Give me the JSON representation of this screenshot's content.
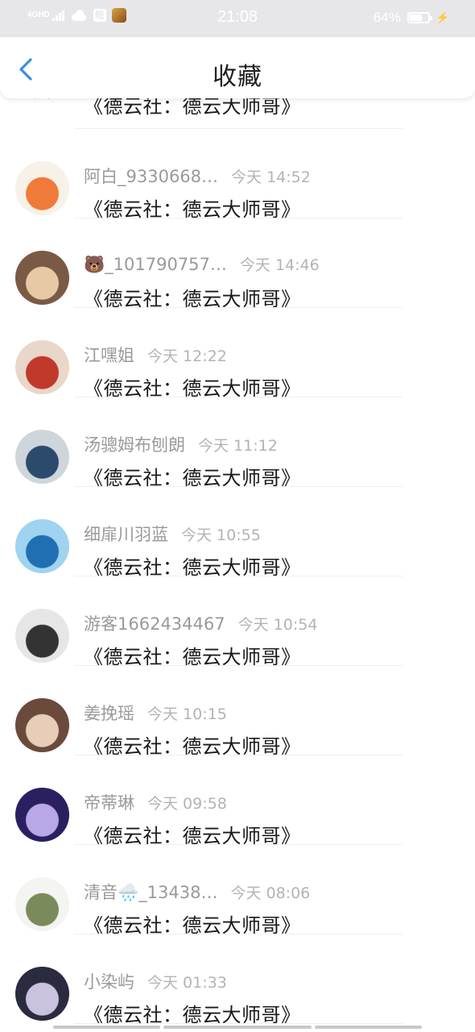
{
  "status_bar": {
    "network": "4GHD",
    "app_icon_1": "短",
    "time": "21:08",
    "battery_pct": "64%",
    "battery_level": 0.64,
    "icons": [
      "signal-icon",
      "cloud-icon",
      "app-icon",
      "game-icon",
      "battery-icon",
      "charging-icon"
    ]
  },
  "header": {
    "title": "收藏",
    "back_icon": "chevron-left-icon",
    "accent": "#3a8ee6"
  },
  "partial_item": {
    "title": "《德云社：德云大师哥》"
  },
  "items": [
    {
      "username": "阿白_9330668…",
      "time": "今天 14:52",
      "title": "《德云社：德云大师哥》",
      "avatar_colors": [
        "#f7f1e8",
        "#f07a3a"
      ]
    },
    {
      "username": "🐻_101790757…",
      "time": "今天 14:46",
      "title": "《德云社：德云大师哥》",
      "avatar_colors": [
        "#7a5a44",
        "#e7c9a6"
      ]
    },
    {
      "username": "江嘿姐",
      "time": "今天 12:22",
      "title": "《德云社：德云大师哥》",
      "avatar_colors": [
        "#e9d7c9",
        "#c0392b"
      ]
    },
    {
      "username": "汤骢姆布刨朗",
      "time": "今天 11:12",
      "title": "《德云社：德云大师哥》",
      "avatar_colors": [
        "#cfd6db",
        "#2c4a6b"
      ]
    },
    {
      "username": "细扉川羽蓝",
      "time": "今天 10:55",
      "title": "《德云社：德云大师哥》",
      "avatar_colors": [
        "#9fd3f0",
        "#1f6fb2"
      ]
    },
    {
      "username": "游客1662434467",
      "time": "今天 10:54",
      "title": "《德云社：德云大师哥》",
      "avatar_colors": [
        "#e6e6e6",
        "#333333"
      ]
    },
    {
      "username": "姜挽瑶",
      "time": "今天 10:15",
      "title": "《德云社：德云大师哥》",
      "avatar_colors": [
        "#6b4a3c",
        "#e8cdb8"
      ]
    },
    {
      "username": "帝蒂琳",
      "time": "今天 09:58",
      "title": "《德云社：德云大师哥》",
      "avatar_colors": [
        "#2a2060",
        "#b8a8e8"
      ]
    },
    {
      "username": "清音🌧️_13438…",
      "time": "今天 08:06",
      "title": "《德云社：德云大师哥》",
      "avatar_colors": [
        "#f4f4f0",
        "#7a8a5a"
      ]
    },
    {
      "username": "小染屿",
      "time": "今天 01:33",
      "title": "《德云社：德云大师哥》",
      "avatar_colors": [
        "#2b2b3f",
        "#c9c3e0"
      ]
    }
  ]
}
